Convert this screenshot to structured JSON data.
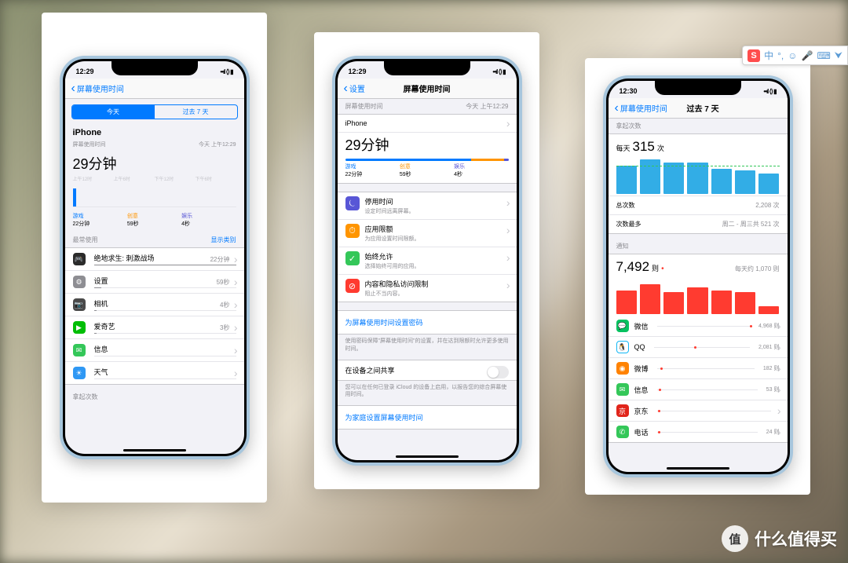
{
  "ime": {
    "logo": "S",
    "mode": "中",
    "icons": [
      "°,",
      "☺",
      "🎤",
      "⌨",
      "⮟"
    ]
  },
  "watermark": {
    "badge": "值",
    "text": "什么值得买"
  },
  "p1": {
    "time": "12:29",
    "back": "屏幕使用时间",
    "seg": {
      "today": "今天",
      "week": "过去 7 天"
    },
    "device": "iPhone",
    "subhead": "屏幕使用时间",
    "subtime": "今天 上午12:29",
    "total": "29分钟",
    "axis": [
      "上午12时",
      "上午6时",
      "下午12时",
      "下午6时"
    ],
    "cats": [
      {
        "n": "游戏",
        "v": "22分钟"
      },
      {
        "n": "创意",
        "v": "59秒"
      },
      {
        "n": "娱乐",
        "v": "4秒"
      }
    ],
    "most_h": "最常使用",
    "show_cat": "显示类别",
    "apps": [
      {
        "n": "绝地求生: 刺激战场",
        "v": "22分钟",
        "c": "#2b2b2b",
        "i": "🎮",
        "p": 100
      },
      {
        "n": "设置",
        "v": "59秒",
        "c": "#8e8e93",
        "i": "⚙",
        "p": 5
      },
      {
        "n": "相机",
        "v": "4秒",
        "c": "#4a4a4a",
        "i": "📷",
        "p": 2
      },
      {
        "n": "爱奇艺",
        "v": "3秒",
        "c": "#00be06",
        "i": "▶",
        "p": 2
      },
      {
        "n": "信息",
        "v": "",
        "c": "#34c759",
        "i": "✉",
        "p": 0
      },
      {
        "n": "天气",
        "v": "",
        "c": "#2f98f4",
        "i": "☀",
        "p": 0
      }
    ],
    "pickups": "拿起次数"
  },
  "p2": {
    "time": "12:29",
    "back": "设置",
    "title": "屏幕使用时间",
    "subhead": "屏幕使用时间",
    "subtime": "今天 上午12:29",
    "device": "iPhone",
    "total": "29分钟",
    "cats": [
      {
        "n": "游戏",
        "v": "22分钟"
      },
      {
        "n": "创意",
        "v": "59秒"
      },
      {
        "n": "娱乐",
        "v": "4秒"
      }
    ],
    "opts": [
      {
        "t": "停用时间",
        "d": "设定时间远离屏幕。",
        "c": "#5856d6",
        "i": "⏾"
      },
      {
        "t": "应用限额",
        "d": "为应用设置时间限额。",
        "c": "#ff9500",
        "i": "⏱"
      },
      {
        "t": "始终允许",
        "d": "选择始终可用的应用。",
        "c": "#34c759",
        "i": "✓"
      },
      {
        "t": "内容和隐私访问限制",
        "d": "阻止不当内容。",
        "c": "#ff3b30",
        "i": "⊘"
      }
    ],
    "pass": "为屏幕使用时间设置密码",
    "pass_note": "使用密码保障\"屏幕使用时间\"的设置，并在达到限额时允许更多使用时间。",
    "share": "在设备之间共享",
    "share_note": "您可以在任何已登录 iCloud 的设备上启用，以报告您的综合屏幕使用时间。",
    "family": "为家庭设置屏幕使用时间"
  },
  "p3": {
    "time": "12:30",
    "back": "屏幕使用时间",
    "title": "过去 7 天",
    "pickups_h": "拿起次数",
    "pickup_big_pre": "每天",
    "pickup_big": "315",
    "pickup_big_suf": "次",
    "pickup_bars": [
      36,
      44,
      40,
      40,
      32,
      30,
      26
    ],
    "total_label": "总次数",
    "total_val": "2,208 次",
    "most_label": "次数最多",
    "most_val": "周二 - 周三共 521 次",
    "notif_h": "通知",
    "notif_big": "7,492",
    "notif_suf": "则",
    "notif_avg": "每天约 1,070 则",
    "notif_bars": [
      30,
      38,
      28,
      34,
      30,
      28,
      10
    ],
    "apps": [
      {
        "n": "微信",
        "v": "4,968 则",
        "c": "#07c160",
        "i": "💬",
        "p": 100
      },
      {
        "n": "QQ",
        "v": "2,081 则",
        "c": "#fff",
        "i": "🐧",
        "p": 42,
        "bd": "#12b7f5"
      },
      {
        "n": "微博",
        "v": "182 则",
        "c": "#ff8200",
        "i": "◉",
        "p": 4
      },
      {
        "n": "信息",
        "v": "53 则",
        "c": "#34c759",
        "i": "✉",
        "p": 2
      },
      {
        "n": "京东",
        "v": "",
        "c": "#e1251b",
        "i": "京",
        "p": 1
      },
      {
        "n": "电话",
        "v": "24 则",
        "c": "#34c759",
        "i": "✆",
        "p": 1
      }
    ]
  }
}
